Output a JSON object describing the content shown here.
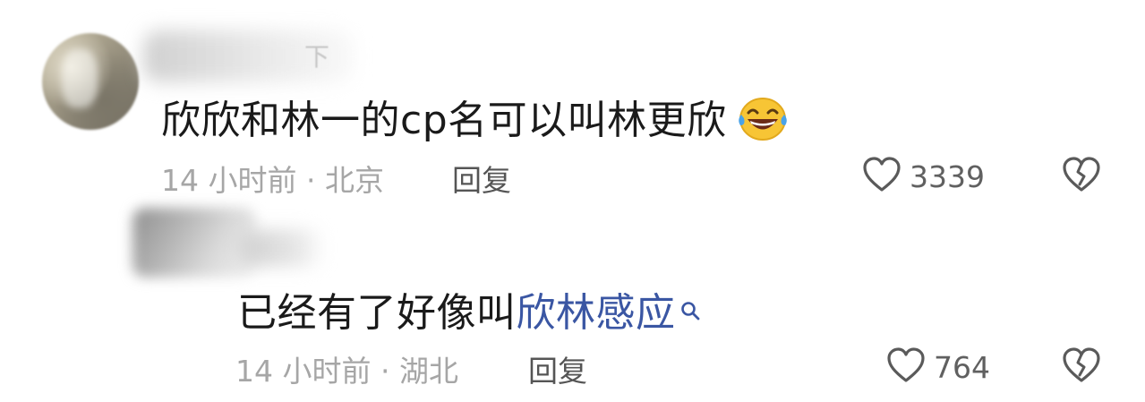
{
  "comments": [
    {
      "text": "欣欣和林一的cp名可以叫林更欣",
      "emoji": "laughing-tears-emoji",
      "meta": "14 小时前 · 北京",
      "reply_label": "回复",
      "likes": "3339"
    },
    {
      "text_prefix": "已经有了好像叫",
      "text_link": "欣林感应",
      "meta": "14 小时前 · 湖北",
      "reply_label": "回复",
      "likes": "764"
    }
  ],
  "colors": {
    "text": "#1a1a1a",
    "meta": "#a6a6a6",
    "link": "#3a56a3",
    "icon": "#555555"
  }
}
